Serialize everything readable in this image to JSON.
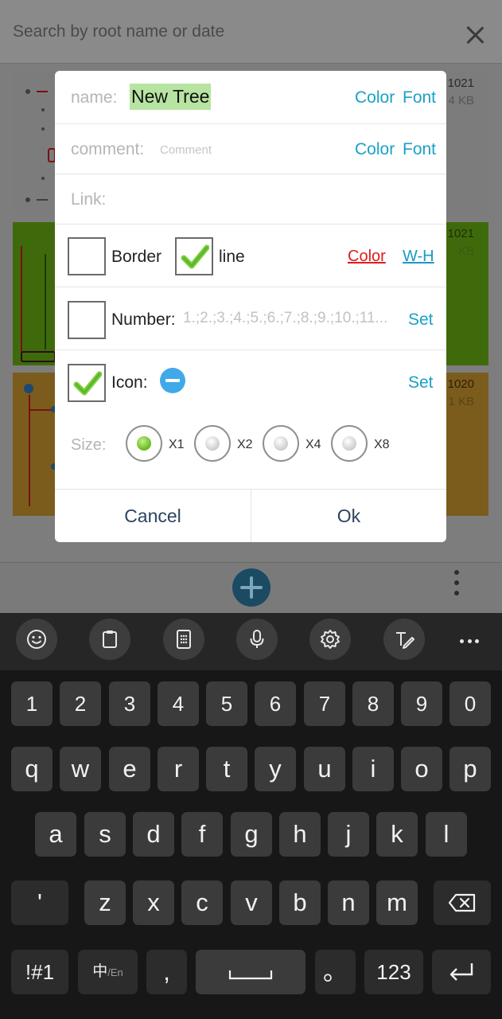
{
  "search": {
    "placeholder": "Search by root name or date"
  },
  "cards": [
    {
      "date": "1021",
      "size": "4 KB"
    },
    {
      "date": "1021",
      "size": "KB"
    },
    {
      "date": "1020",
      "size": "1 KB"
    }
  ],
  "dialog": {
    "name_label": "name:",
    "name_value": "New Tree",
    "name_color": "Color",
    "name_font": "Font",
    "comment_label": "comment:",
    "comment_placeholder": "Comment",
    "comment_color": "Color",
    "comment_font": "Font",
    "link_label": "Link:",
    "border_label": "Border",
    "border_checked": false,
    "line_label": "line",
    "line_checked": true,
    "line_color": "Color",
    "line_wh": "W-H",
    "number_label": "Number:",
    "number_placeholder": "1.;2.;3.;4.;5.;6.;7.;8.;9.;10.;11...",
    "number_checked": false,
    "number_set": "Set",
    "icon_label": "Icon:",
    "icon_checked": true,
    "icon_set": "Set",
    "size_label": "Size:",
    "size_options": [
      "X1",
      "X2",
      "X4",
      "X8"
    ],
    "size_selected": "X1",
    "cancel": "Cancel",
    "ok": "Ok"
  },
  "keyboard": {
    "toolbar": [
      "emoji-icon",
      "clipboard-icon",
      "keypad-icon",
      "microphone-icon",
      "settings-icon",
      "handwriting-icon",
      "more-icon"
    ],
    "row_numbers": [
      "1",
      "2",
      "3",
      "4",
      "5",
      "6",
      "7",
      "8",
      "9",
      "0"
    ],
    "row_1": [
      "q",
      "w",
      "e",
      "r",
      "t",
      "y",
      "u",
      "i",
      "o",
      "p"
    ],
    "row_2": [
      "a",
      "s",
      "d",
      "f",
      "g",
      "h",
      "j",
      "k",
      "l"
    ],
    "row_3": [
      "'",
      "z",
      "x",
      "c",
      "v",
      "b",
      "n",
      "m"
    ],
    "symbols_key": "!#1",
    "lang_key_main": "中",
    "lang_key_sub": "/En",
    "comma_key": ",",
    "period_key": "。",
    "numbers_key": "123"
  },
  "colors": {
    "accent": "#1aa0c8",
    "red_link": "#e01b1b",
    "highlight": "#b7e4a1",
    "keyboard_bg": "#171717"
  }
}
